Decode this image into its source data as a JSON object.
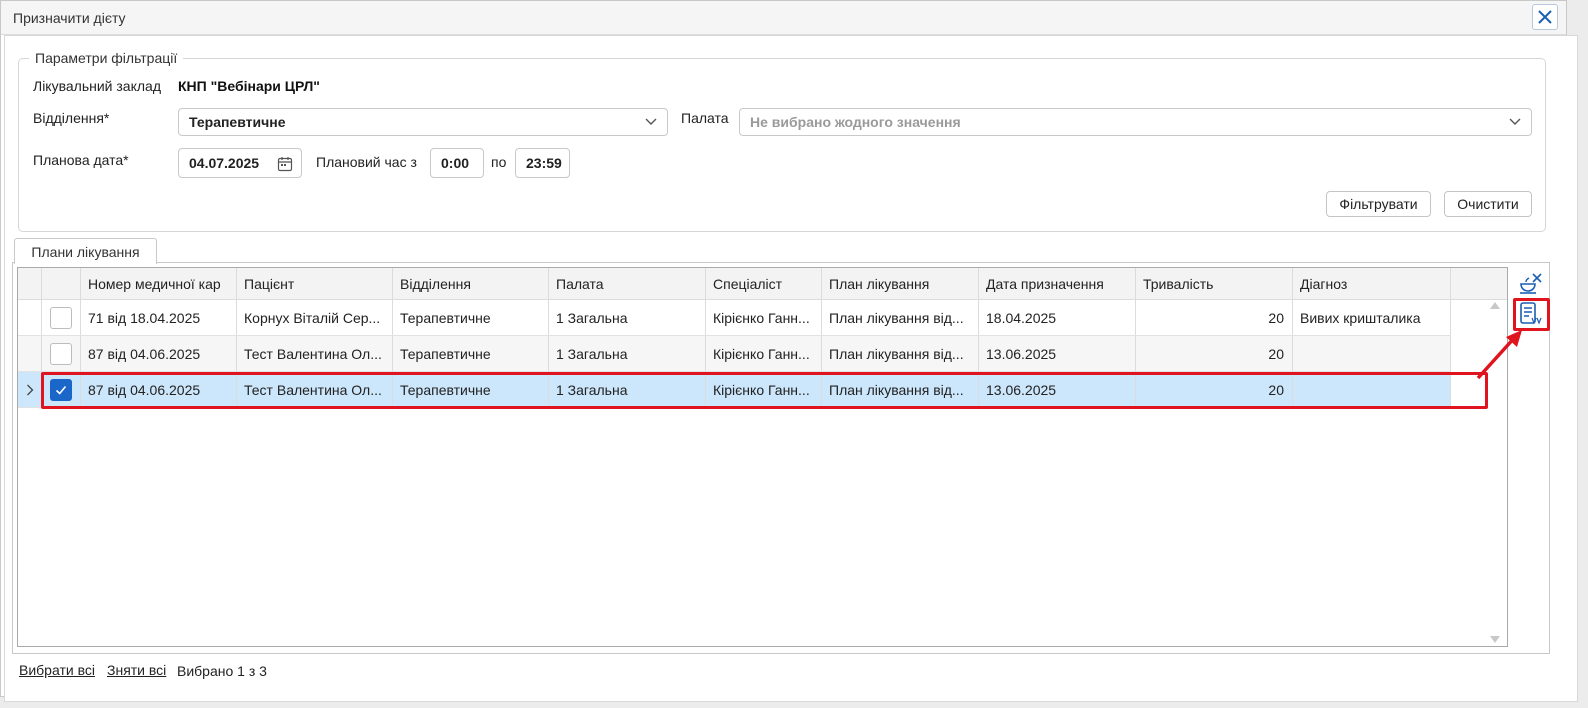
{
  "window": {
    "title": "Призначити дієту"
  },
  "filter": {
    "legend": "Параметри фільтрації",
    "facility_label": "Лікувальний заклад",
    "facility_value": "КНП \"Вебінари ЦРЛ\"",
    "department_label": "Відділення*",
    "department_value": "Терапевтичне",
    "ward_label": "Палата",
    "ward_placeholder": "Не вибрано жодного значення",
    "date_label": "Планова дата*",
    "date_value": "04.07.2025",
    "time_from_label": "Плановий час з",
    "time_from_value": "0:00",
    "time_to_label": "по",
    "time_to_value": "23:59",
    "filter_button": "Фільтрувати",
    "clear_button": "Очистити"
  },
  "tabs": [
    {
      "label": "Плани лікування",
      "active": true
    }
  ],
  "grid": {
    "columns": [
      "Номер медичної кар",
      "Пацієнт",
      "Відділення",
      "Палата",
      "Спеціаліст",
      "План лікування",
      "Дата призначення",
      "Тривалість",
      "Діагноз"
    ],
    "rows": [
      {
        "checked": false,
        "current": false,
        "card": "71 від 18.04.2025",
        "patient": "Корнух Віталій Сер...",
        "department": "Терапевтичне",
        "ward": "1 Загальна",
        "specialist": "Кірієнко Ганн...",
        "plan": "План лікування від...",
        "date": "18.04.2025",
        "duration": "20",
        "diagnosis": "Вивих кришталика"
      },
      {
        "checked": false,
        "current": false,
        "card": "87 від 04.06.2025",
        "patient": "Тест Валентина Ол...",
        "department": "Терапевтичне",
        "ward": "1 Загальна",
        "specialist": "Кірієнко Ганн...",
        "plan": "План лікування від...",
        "date": "13.06.2025",
        "duration": "20",
        "diagnosis": ""
      },
      {
        "checked": true,
        "current": true,
        "card": "87 від 04.06.2025",
        "patient": "Тест Валентина Ол...",
        "department": "Терапевтичне",
        "ward": "1 Загальна",
        "specialist": "Кірієнко Ганн...",
        "plan": "План лікування від...",
        "date": "13.06.2025",
        "duration": "20",
        "diagnosis": ""
      }
    ]
  },
  "footer": {
    "select_all": "Вибрати всі",
    "deselect_all": "Зняти всі",
    "selected_count": "Вибрано 1 з 3"
  },
  "icons": {
    "close": "close-icon",
    "calendar": "calendar-icon",
    "chevron": "chevron-down-icon",
    "diet_tools": "diet-tools-icon",
    "assign_document": "assign-document-icon"
  },
  "colors": {
    "selected_row": "#cce6fb",
    "checkbox_checked": "#1b66c9",
    "highlight": "#e0141e",
    "close_icon": "#1b5fb4"
  }
}
